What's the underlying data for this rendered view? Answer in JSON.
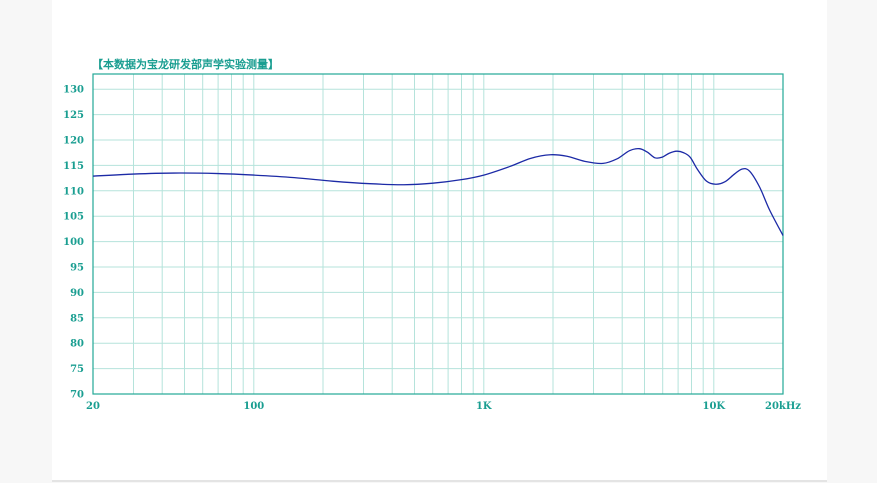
{
  "colors": {
    "accent": "#1a9e91",
    "grid": "#b5e3db",
    "frame": "#22a896",
    "curve": "#1c2aa6",
    "tick_text": "#1a9e91"
  },
  "chart_data": {
    "type": "line",
    "title": "【本数据为宝龙研发部声学实验测量】",
    "xlabel": "",
    "ylabel": "",
    "x_scale": "log",
    "xlim": [
      20,
      20000
    ],
    "ylim": [
      70,
      133
    ],
    "y_ticks": [
      70,
      75,
      80,
      85,
      90,
      95,
      100,
      105,
      110,
      115,
      120,
      125,
      130
    ],
    "x_tick_labels": [
      {
        "value": 20,
        "label": "20"
      },
      {
        "value": 100,
        "label": "100"
      },
      {
        "value": 1000,
        "label": "1K"
      },
      {
        "value": 10000,
        "label": "10K"
      },
      {
        "value": 20000,
        "label": "20kHz"
      }
    ],
    "x_gridlines": [
      30,
      40,
      50,
      60,
      70,
      80,
      90,
      100,
      200,
      300,
      400,
      500,
      600,
      700,
      800,
      900,
      1000,
      2000,
      3000,
      4000,
      5000,
      6000,
      7000,
      8000,
      9000,
      10000
    ],
    "grid": true,
    "series": [
      {
        "values": [
          {
            "x": 20,
            "y": 112.9
          },
          {
            "x": 30,
            "y": 113.3
          },
          {
            "x": 45,
            "y": 113.5
          },
          {
            "x": 70,
            "y": 113.4
          },
          {
            "x": 100,
            "y": 113.1
          },
          {
            "x": 150,
            "y": 112.6
          },
          {
            "x": 220,
            "y": 111.9
          },
          {
            "x": 320,
            "y": 111.4
          },
          {
            "x": 450,
            "y": 111.2
          },
          {
            "x": 600,
            "y": 111.5
          },
          {
            "x": 800,
            "y": 112.2
          },
          {
            "x": 1000,
            "y": 113.1
          },
          {
            "x": 1300,
            "y": 114.8
          },
          {
            "x": 1600,
            "y": 116.4
          },
          {
            "x": 1950,
            "y": 117.1
          },
          {
            "x": 2300,
            "y": 116.8
          },
          {
            "x": 2750,
            "y": 115.8
          },
          {
            "x": 3300,
            "y": 115.4
          },
          {
            "x": 3800,
            "y": 116.3
          },
          {
            "x": 4300,
            "y": 117.9
          },
          {
            "x": 4750,
            "y": 118.3
          },
          {
            "x": 5150,
            "y": 117.6
          },
          {
            "x": 5550,
            "y": 116.5
          },
          {
            "x": 5950,
            "y": 116.6
          },
          {
            "x": 6400,
            "y": 117.4
          },
          {
            "x": 6900,
            "y": 117.8
          },
          {
            "x": 7400,
            "y": 117.5
          },
          {
            "x": 7900,
            "y": 116.6
          },
          {
            "x": 8500,
            "y": 114.2
          },
          {
            "x": 9300,
            "y": 111.9
          },
          {
            "x": 10200,
            "y": 111.3
          },
          {
            "x": 11200,
            "y": 111.8
          },
          {
            "x": 12300,
            "y": 113.3
          },
          {
            "x": 13300,
            "y": 114.3
          },
          {
            "x": 14300,
            "y": 113.9
          },
          {
            "x": 15800,
            "y": 110.8
          },
          {
            "x": 17500,
            "y": 106.2
          },
          {
            "x": 20000,
            "y": 101.2
          }
        ]
      }
    ]
  }
}
